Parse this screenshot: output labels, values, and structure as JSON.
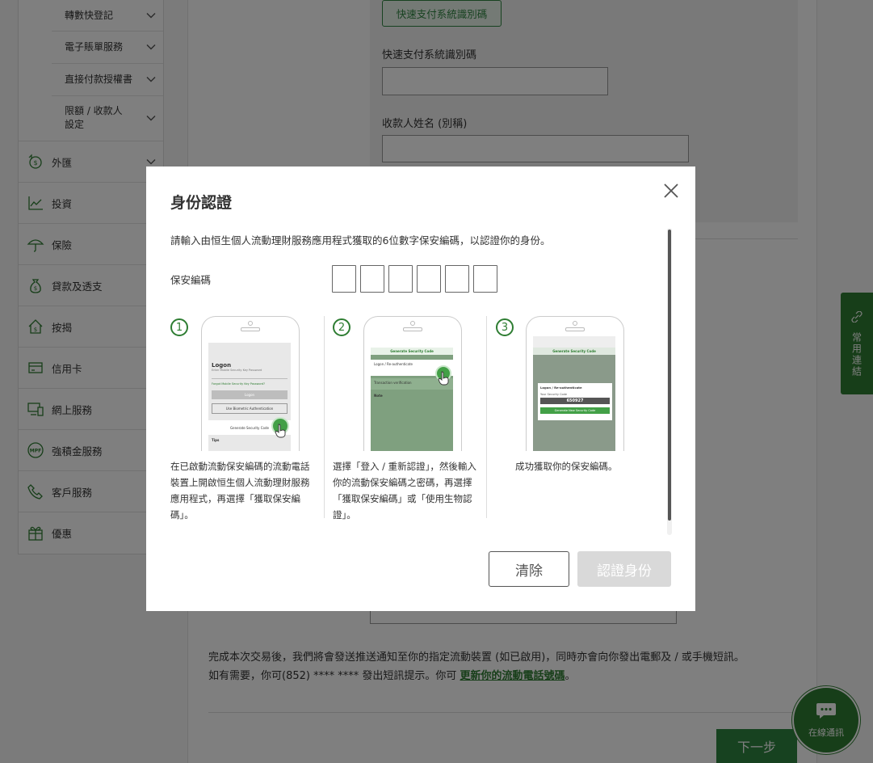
{
  "sidebar": {
    "sub_items": [
      {
        "label": "轉數快登記"
      },
      {
        "label": "電子賬單服務"
      },
      {
        "label": "直接付款授權書"
      },
      {
        "label": "限額 / 收款人設定"
      }
    ],
    "main_items": [
      {
        "label": "外匯",
        "icon": "forex-icon"
      },
      {
        "label": "投資",
        "icon": "chart-icon"
      },
      {
        "label": "保險",
        "icon": "umbrella-icon"
      },
      {
        "label": "貸款及透支",
        "icon": "money-bag-icon"
      },
      {
        "label": "按揭",
        "icon": "house-icon"
      },
      {
        "label": "信用卡",
        "icon": "credit-card-icon"
      },
      {
        "label": "網上服務",
        "icon": "computer-icon"
      },
      {
        "label": "強積金服務",
        "icon": "mpf-icon"
      },
      {
        "label": "客戶服務",
        "icon": "phone-icon"
      },
      {
        "label": "優惠",
        "icon": "gift-icon"
      }
    ]
  },
  "form": {
    "fps_id_button": "快速支付系統識別碼",
    "fps_id_label": "快速支付系統識別碼",
    "fps_id_value": "",
    "payee_name_label": "收款人姓名 (別稱)",
    "payee_name_value": ""
  },
  "notice": {
    "line1": "完成本次交易後，我們將會發送推送通知至你的指定流動裝置 (如已啟用)，同時亦會向你發出電郵及 / 或手機短訊。",
    "line2_prefix": "如有需要，你可(852) **** **** 發出短訊提示。你可",
    "line2_link": "更新你的流動電話號碼",
    "line2_suffix": "。"
  },
  "next_button": "下一步",
  "side_tab": "常用連結",
  "chat": "在線通訊",
  "modal": {
    "title": "身份認證",
    "description": "請輸入由恒生個人流動理財服務應用程式獲取的6位數字保安編碼，以認證你的身份。",
    "code_label": "保安編碼",
    "code_digits": [
      "",
      "",
      "",
      "",
      "",
      ""
    ],
    "steps": [
      {
        "num": "1",
        "text": "在已啟動流動保安編碼的流動電話裝置上開啟恒生個人流動理財服務應用程式，再選擇「獲取保安編碼」。"
      },
      {
        "num": "2",
        "text": "選擇「登入 / 重新認證」，然後輸入你的流動保安編碼之密碼，再選擇「獲取保安編碼」或「使用生物認證」。"
      },
      {
        "num": "3",
        "text": "成功獲取你的保安編碼。"
      }
    ],
    "phone1": {
      "heading": "Logon",
      "sub": "Enter Mobile Security Key Password",
      "forgot": "Forgot Mobile Security Key Password?",
      "logon_btn": "Logon",
      "bio": "Use Biometric Authentication",
      "gen": "Generate Security Code",
      "tips": "Tips"
    },
    "phone2": {
      "title": "Generate Security Code",
      "opt1": "Logon / Re-authenticate",
      "opt2": "Transaction verification",
      "note": "Note"
    },
    "phone3": {
      "title": "Generate Security Code",
      "popup_title": "Logon / Re-authenticate",
      "code_label": "Your Security Code",
      "code": "650927",
      "gen_btn": "Generate New Security Code"
    },
    "clear_button": "清除",
    "auth_button": "認證身份"
  },
  "colors": {
    "brand_green": "#2e7d32",
    "accent_green": "#2e8540",
    "disabled": "#d9d9d9"
  }
}
